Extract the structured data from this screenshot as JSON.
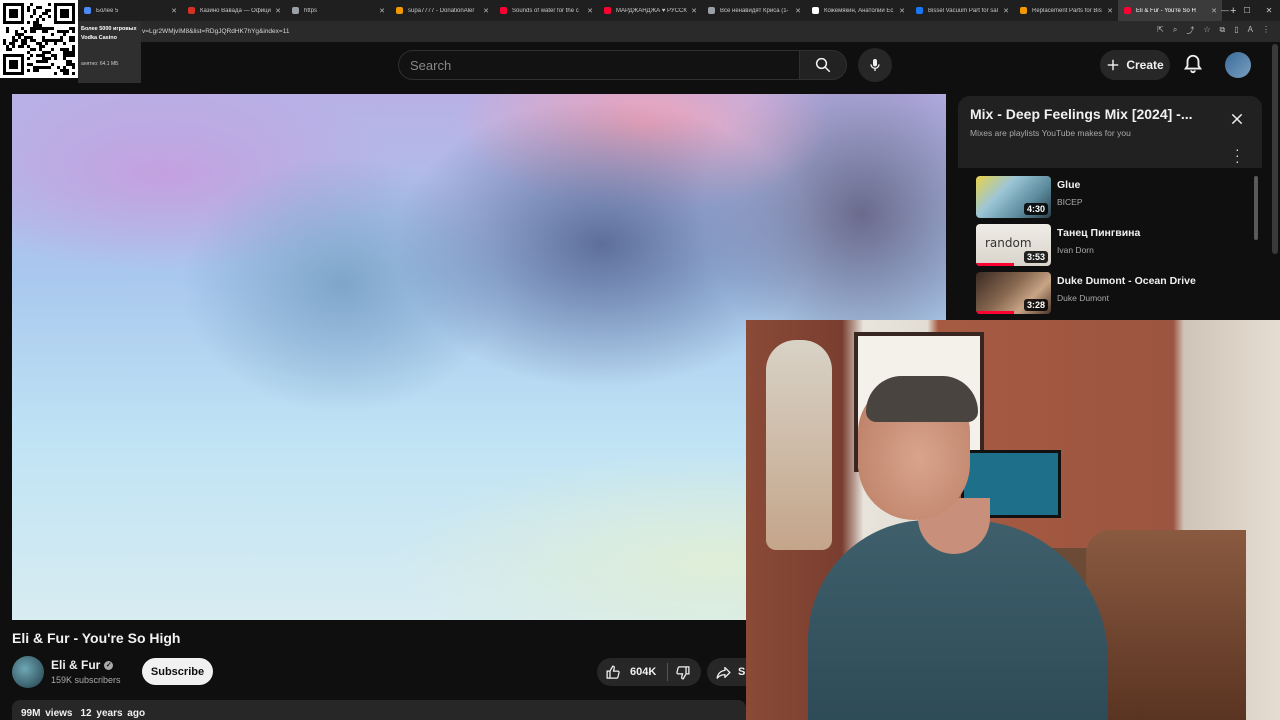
{
  "browser": {
    "tabs": [
      {
        "label": "Более 5",
        "color": "#4a8af4"
      },
      {
        "label": "Казино Вавада — Офици",
        "color": "#d93025"
      },
      {
        "label": "https",
        "color": "#9aa0a6"
      },
      {
        "label": "supa7777 - DonationAler",
        "color": "#f29900"
      },
      {
        "label": "Sounds of water for the c",
        "color": "#ff0033"
      },
      {
        "label": "МАРДЖАНДЖА ♥ РУССК",
        "color": "#ff0033"
      },
      {
        "label": "Все ненавидят Криса (1-",
        "color": "#9aa0a6"
      },
      {
        "label": "Кожемякин, Анатолий Ес",
        "color": "#ffffff"
      },
      {
        "label": "Bissel Vacuum Part for sal",
        "color": "#1877f2"
      },
      {
        "label": "Replacement Parts for Bis",
        "color": "#f29900"
      },
      {
        "label": "Eli & Fur - You're So H",
        "color": "#ff0033",
        "active": true
      }
    ],
    "url": "v=Lgr2WMjvIM8&list=RDgJQRdHK7hYg&index=11"
  },
  "overlay": {
    "line1": "Более 5000 игровых",
    "line2": "Vodka Casino",
    "line3": "анятно: 64.1 МБ"
  },
  "header": {
    "search_placeholder": "Search",
    "create_label": "Create"
  },
  "video": {
    "title": "Eli & Fur - You're So High",
    "channel": "Eli & Fur",
    "subscribers": "159K subscribers",
    "subscribe_label": "Subscribe",
    "likes": "604K",
    "share_label": "Sh",
    "views": "99M views",
    "age": "12 years ago"
  },
  "playlist": {
    "title": "Mix - Deep Feelings Mix [2024] -...",
    "subtitle": "Mixes are playlists YouTube makes for you",
    "items": [
      {
        "title": "Glue",
        "artist": "BICEP",
        "duration": "4:30",
        "progress": 0
      },
      {
        "title": "Танец Пингвина",
        "artist": "Ivan Dorn",
        "duration": "3:53",
        "progress": 0.5
      },
      {
        "title": "Duke Dumont - Ocean Drive",
        "artist": "Duke Dumont",
        "duration": "3:28",
        "progress": 0.5
      }
    ]
  }
}
